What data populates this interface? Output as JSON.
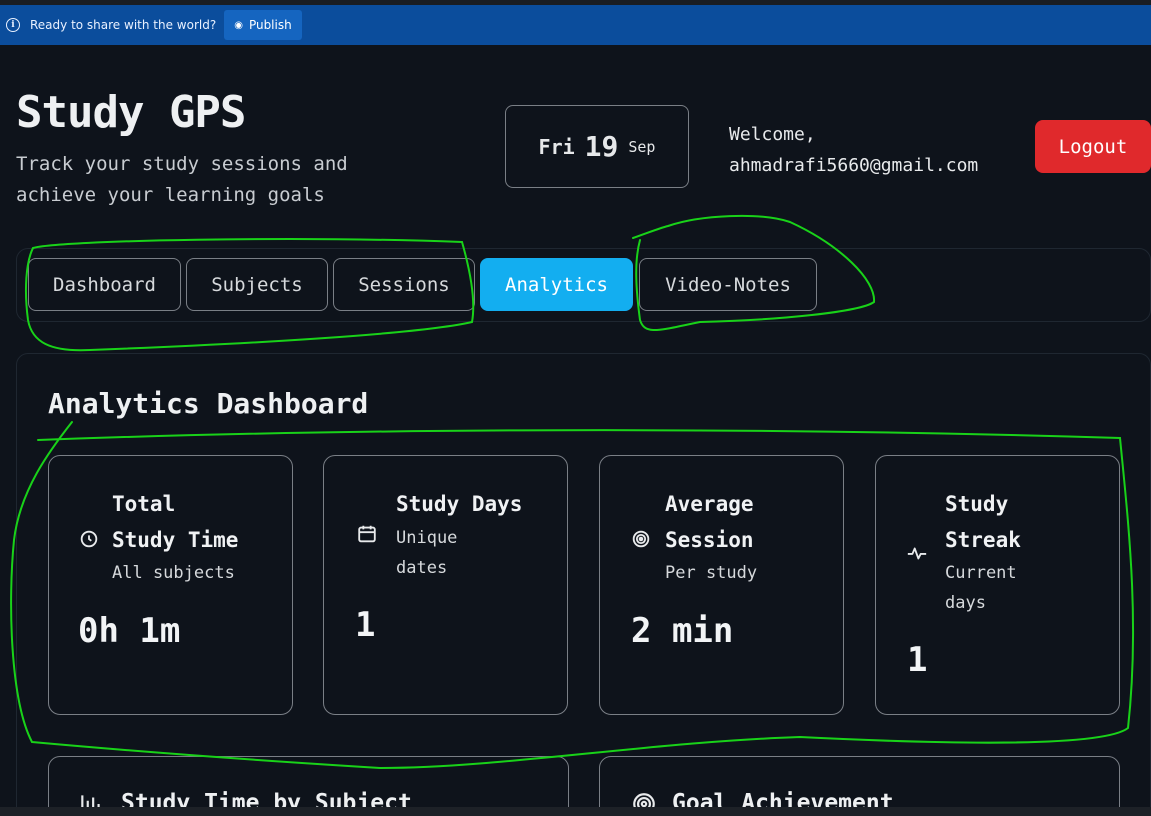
{
  "publish_bar": {
    "message": "Ready to share with the world?",
    "button_label": "Publish"
  },
  "header": {
    "title": "Study GPS",
    "subtitle_line1": "Track your study sessions and",
    "subtitle_line2": "achieve your learning goals",
    "date_day": "Fri",
    "date_num": "19",
    "date_month": "Sep",
    "welcome_label": "Welcome,",
    "user_email": "ahmadrafi5660@gmail.com",
    "logout_label": "Logout"
  },
  "tabs": [
    {
      "label": "Dashboard",
      "active": false
    },
    {
      "label": "Subjects",
      "active": false
    },
    {
      "label": "Sessions",
      "active": false
    },
    {
      "label": "Analytics",
      "active": true
    },
    {
      "label": "Video-Notes",
      "active": false
    }
  ],
  "analytics": {
    "title": "Analytics Dashboard",
    "cards": [
      {
        "icon": "clock-icon",
        "title_line1": "Total",
        "title_line2": "Study Time",
        "desc_line1": "All subjects",
        "desc_line2": "",
        "value": "0h 1m"
      },
      {
        "icon": "calendar-icon",
        "title_line1": "Study Days",
        "title_line2": "",
        "desc_line1": "Unique",
        "desc_line2": "dates",
        "value": "1"
      },
      {
        "icon": "target-icon",
        "title_line1": "Average",
        "title_line2": "Session",
        "desc_line1": "Per study",
        "desc_line2": "",
        "value": "2 min"
      },
      {
        "icon": "activity-icon",
        "title_line1": "Study",
        "title_line2": "Streak",
        "desc_line1": "Current",
        "desc_line2": "days",
        "value": "1"
      }
    ],
    "lower_sections": [
      {
        "icon": "bar-chart-icon",
        "title": "Study Time by Subject"
      },
      {
        "icon": "target-icon",
        "title": "Goal Achievement"
      }
    ]
  },
  "colors": {
    "background": "#0e131b",
    "publish_bar": "#0b4d9c",
    "active_tab": "#13aef0",
    "logout": "#e0292c",
    "annotation": "#19d219"
  }
}
